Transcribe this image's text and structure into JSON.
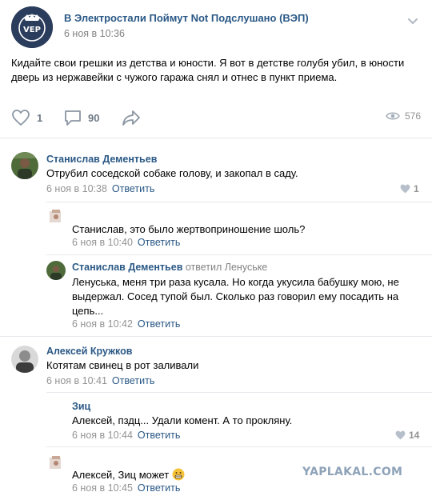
{
  "post": {
    "group_name": "В Электростали Поймут Not Подслушано (ВЭП)",
    "date": "6 ноя в 10:36",
    "text": "Кидайте свои грешки из детства и юности. Я вот в детстве голубя убил, в юности дверь из нержавейки с чужого гаража снял и отнес в пункт приема.",
    "likes": "1",
    "comments": "90",
    "views": "576",
    "avatar_text": "VEP"
  },
  "comments": [
    {
      "author": "Станислав Дементьев",
      "text": "Отрубил соседской собаке голову, и закопал в саду.",
      "date": "6 ноя в 10:38",
      "reply": "Ответить",
      "likes": "1"
    },
    {
      "author": "",
      "text": "Станислав, это было жертвоприношение шоль?",
      "date": "6 ноя в 10:40",
      "reply": "Ответить"
    },
    {
      "author": "Станислав Дементьев",
      "replied_to": "ответил Ленуське",
      "text": "Ленуська, меня три раза кусала. Но когда укусила бабушку мою, не выдержал. Сосед тупой был. Сколько раз говорил ему посадить на цепь...",
      "date": "6 ноя в 10:42",
      "reply": "Ответить"
    },
    {
      "author": "Алексей Кружков",
      "text": "Котятам свинец в рот заливали",
      "date": "6 ноя в 10:41",
      "reply": "Ответить"
    },
    {
      "author": "Зиц",
      "text": "Алексей, пздц... Удали комент. А то прокляну.",
      "date": "6 ноя в 10:44",
      "reply": "Ответить",
      "likes": "14"
    },
    {
      "author": "",
      "text": "Алексей, Зиц может",
      "date": "6 ноя в 10:45",
      "reply": "Ответить"
    }
  ],
  "watermark": "YAPLAKAL.COM",
  "colors": {
    "link": "#2a5885",
    "muted": "#939393",
    "separator": "#e7e8ec"
  }
}
